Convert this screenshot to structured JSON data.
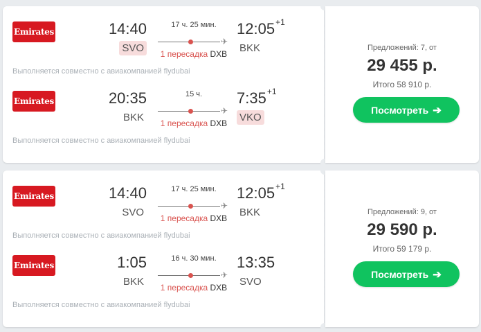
{
  "tickets": [
    {
      "flights": [
        {
          "airline": "Emirates",
          "dep_time": "14:40",
          "dep_code": "SVO",
          "arr_time": "12:05",
          "arr_day": "+1",
          "arr_code": "BKK",
          "duration": "17 ч. 25 мин.",
          "stops_label": "1 пересадка",
          "stop_code": "DXB",
          "note": "Выполняется совместно с авиакомпанией flydubai"
        },
        {
          "airline": "Emirates",
          "dep_time": "20:35",
          "dep_code": "BKK",
          "arr_time": "7:35",
          "arr_day": "+1",
          "arr_code": "VKO",
          "duration": "15 ч.",
          "stops_label": "1 пересадка",
          "stop_code": "DXB",
          "note": "Выполняется совместно с авиакомпанией flydubai"
        }
      ],
      "offers": "Предложений: 7, от",
      "price": "29 455 р.",
      "total": "Итого 58 910 р.",
      "button": "Посмотреть",
      "button_icon": "➔"
    },
    {
      "flights": [
        {
          "airline": "Emirates",
          "dep_time": "14:40",
          "dep_code": "SVO",
          "arr_time": "12:05",
          "arr_day": "+1",
          "arr_code": "BKK",
          "duration": "17 ч. 25 мин.",
          "stops_label": "1 пересадка",
          "stop_code": "DXB",
          "note": "Выполняется совместно с авиакомпанией flydubai"
        },
        {
          "airline": "Emirates",
          "dep_time": "1:05",
          "dep_code": "BKK",
          "arr_time": "13:35",
          "arr_day": "",
          "arr_code": "SVO",
          "duration": "16 ч. 30 мин.",
          "stops_label": "1 пересадка",
          "stop_code": "DXB",
          "note": "Выполняется совместно с авиакомпанией flydubai"
        }
      ],
      "offers": "Предложений: 9, от",
      "price": "29 590 р.",
      "total": "Итого 59 179 р.",
      "button": "Посмотреть",
      "button_icon": "➔"
    }
  ],
  "colors": {
    "button": "#10c35f",
    "airline_logo": "#d71921",
    "stop_dot": "#d9534f",
    "airport_highlight": "#f7dcdc"
  },
  "icons": {
    "plane": "✈"
  }
}
